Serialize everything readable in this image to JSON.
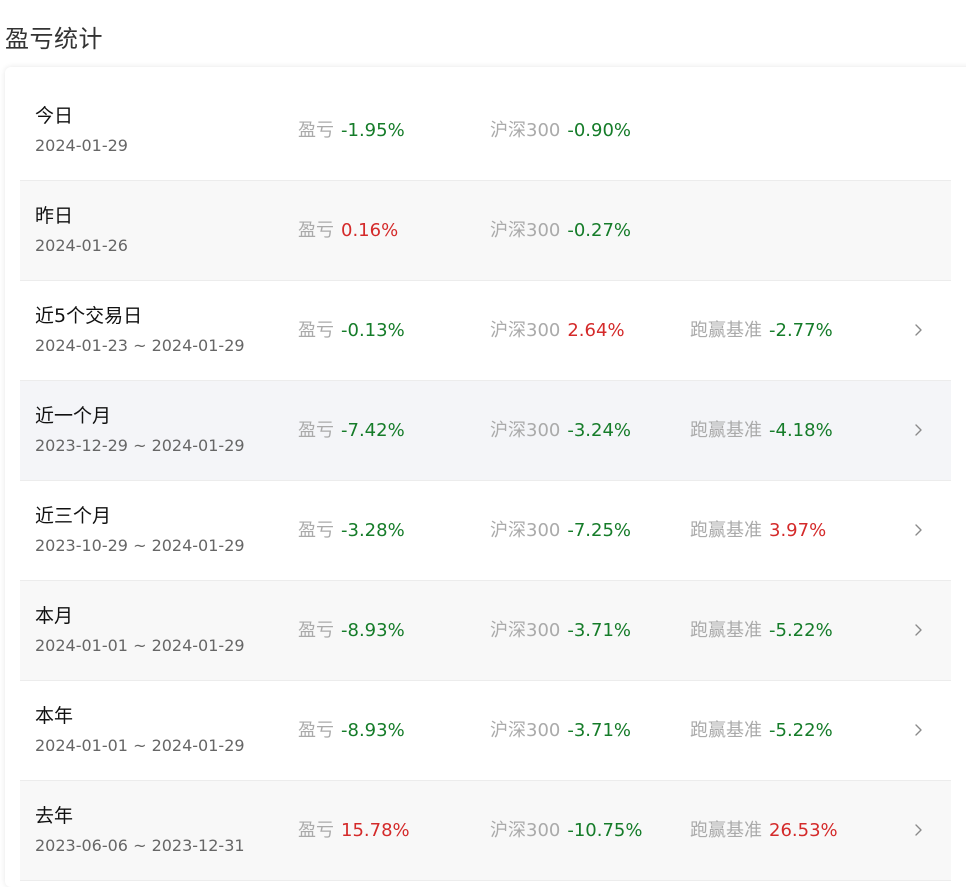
{
  "page_title": "盈亏统计",
  "labels": {
    "pnl": "盈亏",
    "index": "沪深300",
    "beat": "跑赢基准"
  },
  "colors": {
    "negative": "#157c29",
    "positive": "#d42a2a",
    "label": "#aaaaaa"
  },
  "rows": [
    {
      "title": "今日",
      "date": "2024-01-29",
      "pnl": "-1.95%",
      "index": "-0.90%",
      "beat": null,
      "chevron": false
    },
    {
      "title": "昨日",
      "date": "2024-01-26",
      "pnl": "0.16%",
      "index": "-0.27%",
      "beat": null,
      "chevron": false
    },
    {
      "title": "近5个交易日",
      "date": "2024-01-23 ~ 2024-01-29",
      "pnl": "-0.13%",
      "index": "2.64%",
      "beat": "-2.77%",
      "chevron": true
    },
    {
      "title": "近一个月",
      "date": "2023-12-29 ~ 2024-01-29",
      "pnl": "-7.42%",
      "index": "-3.24%",
      "beat": "-4.18%",
      "chevron": true
    },
    {
      "title": "近三个月",
      "date": "2023-10-29 ~ 2024-01-29",
      "pnl": "-3.28%",
      "index": "-7.25%",
      "beat": "3.97%",
      "chevron": true
    },
    {
      "title": "本月",
      "date": "2024-01-01 ~ 2024-01-29",
      "pnl": "-8.93%",
      "index": "-3.71%",
      "beat": "-5.22%",
      "chevron": true
    },
    {
      "title": "本年",
      "date": "2024-01-01 ~ 2024-01-29",
      "pnl": "-8.93%",
      "index": "-3.71%",
      "beat": "-5.22%",
      "chevron": true
    },
    {
      "title": "去年",
      "date": "2023-06-06 ~ 2023-12-31",
      "pnl": "15.78%",
      "index": "-10.75%",
      "beat": "26.53%",
      "chevron": true
    }
  ]
}
